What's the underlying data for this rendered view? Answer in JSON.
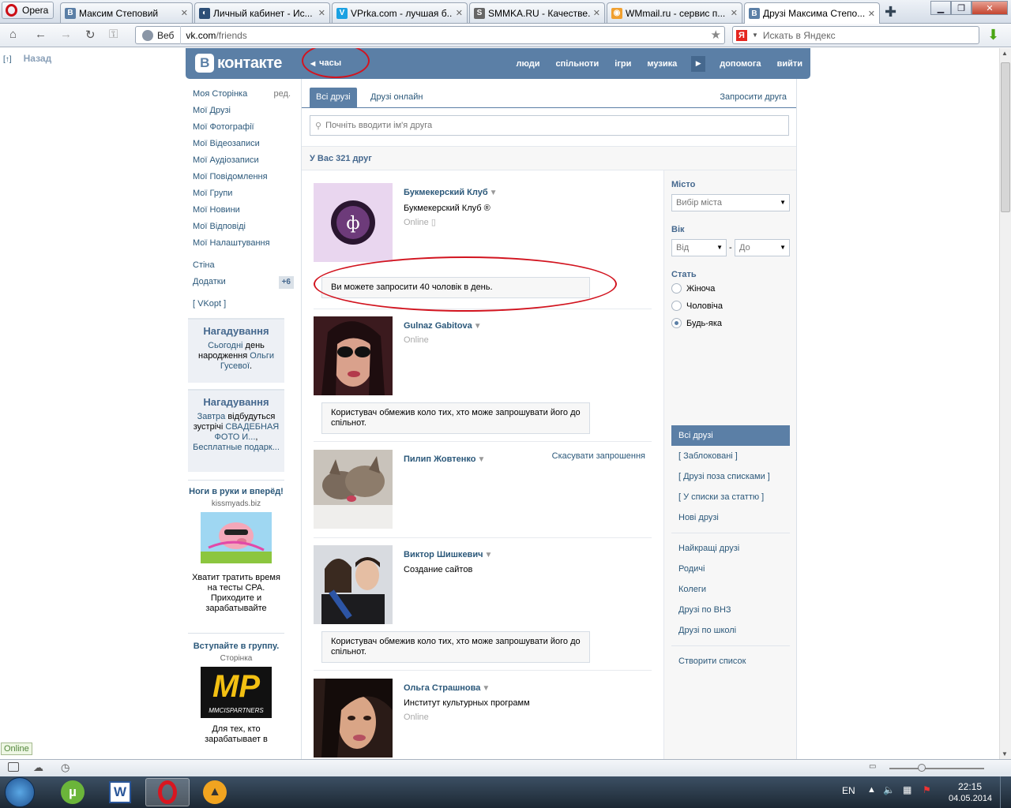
{
  "browser": {
    "menu_label": "Opera",
    "tabs": [
      {
        "title": "Максим Степовий",
        "fav": "В",
        "color": "#5b7fa6"
      },
      {
        "title": "Личный кабинет - Ис...",
        "fav": "◐",
        "color": "#2d4f77"
      },
      {
        "title": "VPrka.com - лучшая б...",
        "fav": "V",
        "color": "#1ba1e2"
      },
      {
        "title": "SMMKA.RU - Качестве...",
        "fav": "S",
        "color": "#666"
      },
      {
        "title": "WMmail.ru - сервис п...",
        "fav": "◉",
        "color": "#f0a030"
      },
      {
        "title": "Друзі Максима Степо...",
        "fav": "В",
        "color": "#5b7fa6"
      }
    ],
    "address_label": "Веб",
    "url_host": "vk.com",
    "url_path": "/friends",
    "search_placeholder": "Искать в Яндекс",
    "yandex_letter": "Я"
  },
  "page": {
    "back_label": "Назад",
    "back_mark": "[↑]",
    "header": {
      "logo_letter": "В",
      "logo_text": "контакте",
      "status": "часы",
      "menu": [
        "люди",
        "спільноти",
        "ігри",
        "музика",
        "допомога",
        "вийти"
      ]
    },
    "left_menu": {
      "items": [
        "Моя Сторінка",
        "Мої Друзі",
        "Мої Фотографії",
        "Мої Відеозаписи",
        "Мої Аудіозаписи",
        "Мої Повідомлення",
        "Мої Групи",
        "Мої Новини",
        "Мої Відповіді",
        "Мої Налаштування"
      ],
      "edit": "ред.",
      "items2": [
        "Стіна",
        "Додатки"
      ],
      "badge": "+6",
      "vkopt": "[ VKopt ]"
    },
    "reminder1": {
      "title": "Нагадування",
      "link1": "Сьогодні",
      "text1": " день народження ",
      "link2": "Ольги Гусевої",
      "text2": "."
    },
    "reminder2": {
      "title": "Нагадування",
      "link1": "Завтра",
      "text1": " відбудуться зустрічі ",
      "link2": "СВАДЕБНАЯ ФОТО И...",
      "text2": ", ",
      "link3": "Бесплатные подарк..."
    },
    "ad1": {
      "title": "Ноги в руки и вперёд!",
      "source": "kissmyads.biz",
      "text": "Хватит тратить время на тесты CPA. Приходите и зарабатывайте"
    },
    "ad2": {
      "title": "Вступайте в группу.",
      "source": "Сторінка",
      "logo": "MP",
      "logo_sub": "MMCISPARTNERS",
      "text": "Для тех, кто зарабатывает в"
    },
    "tabs": {
      "all": "Всі друзі",
      "online": "Друзі онлайн",
      "invite": "Запросити друга"
    },
    "search_placeholder": "Почніть вводити ім'я друга",
    "summary": "У Вас 321 друг",
    "friends": [
      {
        "name": "Букмекерский Клуб",
        "line2": "Букмекерский Клуб ®",
        "status": "Online"
      },
      {
        "name": "Gulnaz Gabitova",
        "line2": "",
        "status": "Online"
      },
      {
        "name": "Пилип Жовтенко",
        "line2": "",
        "status": "",
        "action": "Скасувати запрошення"
      },
      {
        "name": "Виктор Шишкевич",
        "line2": "Создание сайтов",
        "status": ""
      },
      {
        "name": "Ольга Страшнова",
        "line2": "Институт культурных программ",
        "status": "Online"
      }
    ],
    "notice_limit": "Ви можете запросити 40 чоловік в день.",
    "notice_restricted": "Користувач обмежив коло тих, хто може запрошувати його до спільнот.",
    "filters": {
      "city_label": "Місто",
      "city_value": "Вибір міста",
      "age_label": "Вік",
      "age_from": "Від",
      "age_dash": "-",
      "age_to": "До",
      "gender_label": "Стать",
      "gender_options": [
        "Жіноча",
        "Чоловіча",
        "Будь-яка"
      ],
      "gender_selected": "Будь-яка",
      "lists_active": "Всі друзі",
      "lists": [
        "[ Заблоковані ]",
        "[ Друзі поза списками ]",
        "[ У списки за статтю ]",
        "Нові друзі"
      ],
      "groups": [
        "Найкращі друзі",
        "Родичі",
        "Колеги",
        "Друзі по ВНЗ",
        "Друзі по школі"
      ],
      "create": "Створити список"
    }
  },
  "status_bar": {
    "online": "Online"
  },
  "taskbar": {
    "lang": "EN",
    "time": "22:15",
    "date": "04.05.2014"
  }
}
